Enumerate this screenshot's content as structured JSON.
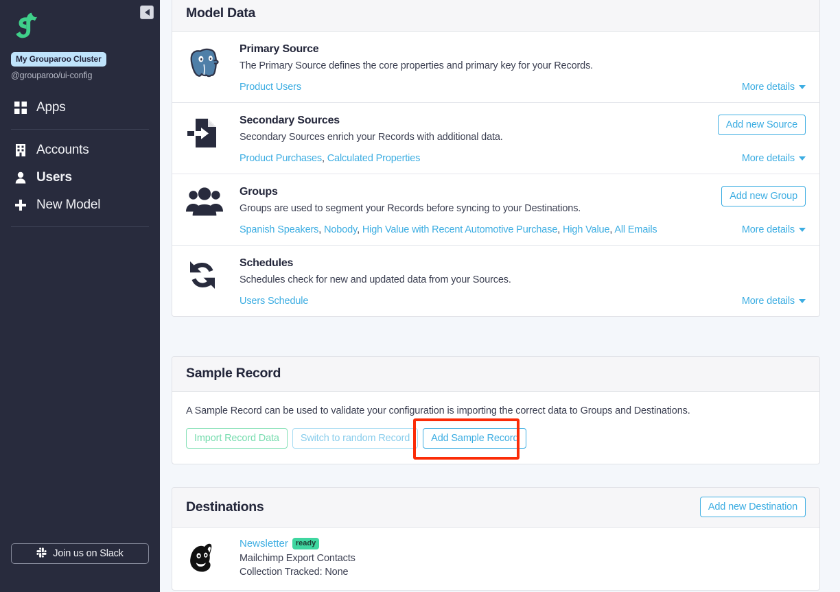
{
  "sidebar": {
    "collapse_icon": "chevron-left-icon",
    "logo_icon": "grouparoo-logo",
    "cluster_badge": "My Grouparoo Cluster",
    "cluster_sub": "@grouparoo/ui-config",
    "nav": [
      {
        "label": "Apps",
        "icon": "grid-icon",
        "active": false
      },
      {
        "label": "Accounts",
        "icon": "building-icon",
        "active": false
      },
      {
        "label": "Users",
        "icon": "user-icon",
        "active": true
      },
      {
        "label": "New Model",
        "icon": "plus-icon",
        "active": false
      }
    ],
    "slack_button": {
      "label": "Join us on Slack",
      "icon": "slack-icon"
    }
  },
  "model_data": {
    "title": "Model Data",
    "rows": [
      {
        "icon": "postgres-elephant-icon",
        "title": "Primary Source",
        "description": "The Primary Source defines the core properties and primary key for your Records.",
        "links": [
          "Product Users"
        ],
        "button": null,
        "more_details": "More details"
      },
      {
        "icon": "import-file-icon",
        "title": "Secondary Sources",
        "description": "Secondary Sources enrich your Records with additional data.",
        "links": [
          "Product Purchases",
          "Calculated Properties"
        ],
        "button": "Add new Source",
        "more_details": "More details"
      },
      {
        "icon": "group-people-icon",
        "title": "Groups",
        "description": "Groups are used to segment your Records before syncing to your Destinations.",
        "links": [
          "Spanish Speakers",
          "Nobody",
          "High Value with Recent Automotive Purchase",
          "High Value",
          "All Emails"
        ],
        "button": "Add new Group",
        "more_details": "More details"
      },
      {
        "icon": "refresh-sync-icon",
        "title": "Schedules",
        "description": "Schedules check for new and updated data from your Sources.",
        "links": [
          "Users Schedule"
        ],
        "button": null,
        "more_details": "More details"
      }
    ]
  },
  "sample_record": {
    "title": "Sample Record",
    "description": "A Sample Record can be used to validate your configuration is importing the correct data to Groups and Destinations.",
    "buttons": [
      {
        "label": "Import Record Data",
        "style": "green"
      },
      {
        "label": "Switch to random Record",
        "style": "muted"
      },
      {
        "label": "Add Sample Record",
        "style": "primary",
        "highlighted": true
      }
    ]
  },
  "destinations": {
    "title": "Destinations",
    "add_button": "Add new Destination",
    "items": [
      {
        "icon": "mailchimp-icon",
        "name": "Newsletter",
        "status": "ready",
        "subtitle": "Mailchimp Export Contacts",
        "collection": "Collection Tracked: None"
      }
    ]
  },
  "colors": {
    "sidebar_bg": "#282b3d",
    "link_blue": "#3cade2",
    "badge_blue": "#bfe3fb",
    "ready_green": "#3fd6a0",
    "highlight_red": "#fb2c08",
    "logo_green": "#3fd08a",
    "page_bg": "#f4f7fb"
  }
}
